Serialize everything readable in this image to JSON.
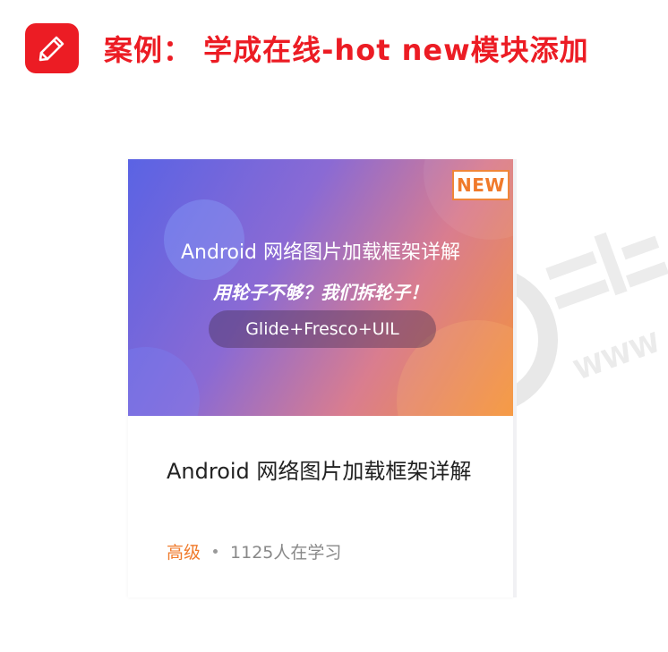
{
  "header": {
    "title": "案例： 学成在线-hot  new模块添加",
    "icon": "pencil-icon",
    "accent_color": "#ec1c24"
  },
  "card": {
    "badge": "NEW",
    "banner": {
      "title": "Android 网络图片加载框架详解",
      "slogan": "用轮子不够？我们拆轮子！",
      "pill": "Glide+Fresco+UIL"
    },
    "course_title": "Android 网络图片加载框架详解",
    "level": "高级",
    "learners": "1125人在学习",
    "level_color": "#f07a2b"
  }
}
